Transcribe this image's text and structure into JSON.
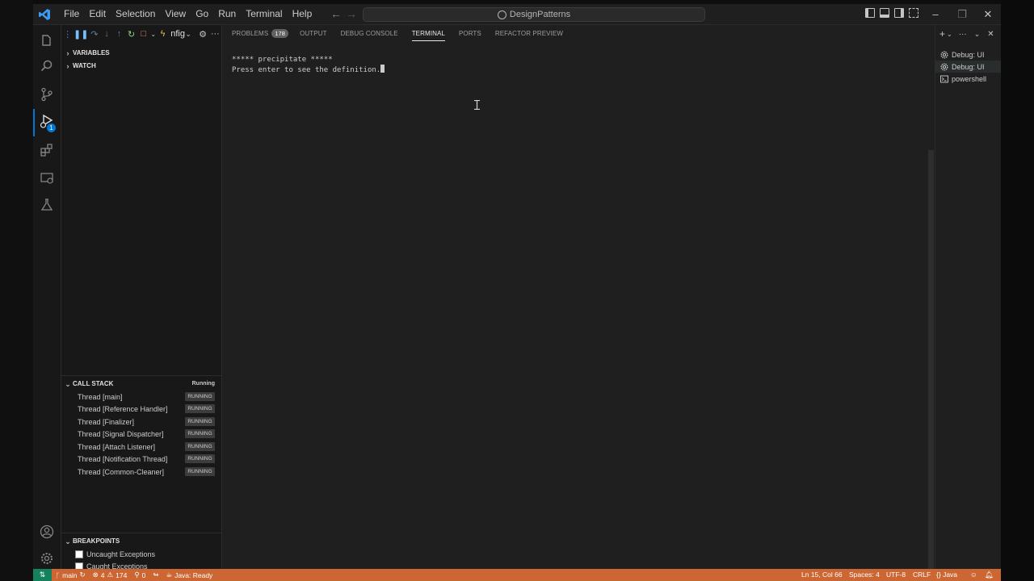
{
  "titlebar": {
    "menu": [
      "File",
      "Edit",
      "Selection",
      "View",
      "Go",
      "Run",
      "Terminal",
      "Help"
    ],
    "search_text": "DesignPatterns"
  },
  "debug_toolbar": {
    "config_label": "nfig"
  },
  "sidebar": {
    "variables_header": "VARIABLES",
    "watch_header": "WATCH",
    "callstack_header": "CALL STACK",
    "callstack_status": "Running",
    "threads": [
      {
        "name": "Thread [main]",
        "state": "RUNNING"
      },
      {
        "name": "Thread [Reference Handler]",
        "state": "RUNNING"
      },
      {
        "name": "Thread [Finalizer]",
        "state": "RUNNING"
      },
      {
        "name": "Thread [Signal Dispatcher]",
        "state": "RUNNING"
      },
      {
        "name": "Thread [Attach Listener]",
        "state": "RUNNING"
      },
      {
        "name": "Thread [Notification Thread]",
        "state": "RUNNING"
      },
      {
        "name": "Thread [Common-Cleaner]",
        "state": "RUNNING"
      }
    ],
    "breakpoints_header": "BREAKPOINTS",
    "breakpoints": [
      "Uncaught Exceptions",
      "Caught Exceptions"
    ],
    "debug_badge": "1"
  },
  "panel": {
    "tabs": [
      "PROBLEMS",
      "OUTPUT",
      "DEBUG CONSOLE",
      "TERMINAL",
      "PORTS",
      "REFACTOR PREVIEW"
    ],
    "problems_count": "178",
    "terminal_lines": [
      "***** precipitate *****",
      "Press enter to see the definition."
    ]
  },
  "terminals": [
    "Debug: UI",
    "Debug: UI",
    "powershell"
  ],
  "statusbar": {
    "branch": "main",
    "errors": "4",
    "warnings": "174",
    "ports": "0",
    "java_status": "Java: Ready",
    "position": "Ln 15, Col 66",
    "spaces": "Spaces: 4",
    "encoding": "UTF-8",
    "eol": "CRLF",
    "language": "Java"
  },
  "colors": {
    "accent": "#0078d4",
    "statusbar": "#cc6633",
    "remote": "#16825d"
  }
}
